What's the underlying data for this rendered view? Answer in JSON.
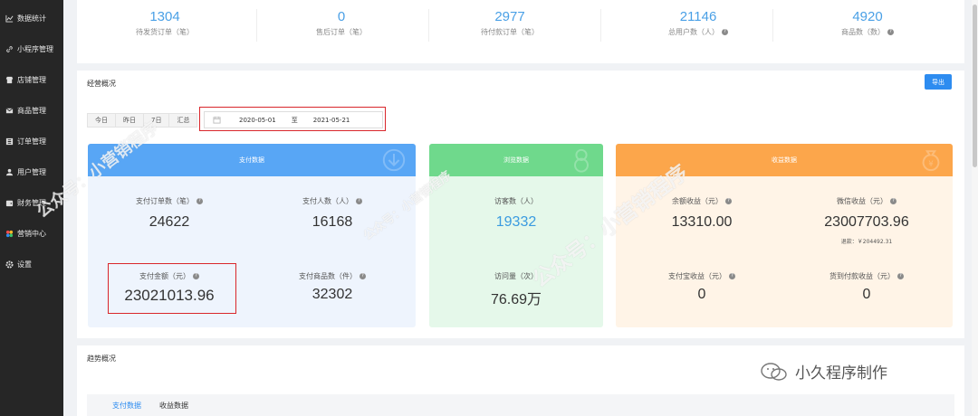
{
  "sidebar": {
    "items": [
      {
        "label": "数据统计",
        "icon": "chart-line-icon"
      },
      {
        "label": "小程序管理",
        "icon": "link-icon"
      },
      {
        "label": "店铺管理",
        "icon": "store-icon"
      },
      {
        "label": "商品管理",
        "icon": "envelope-icon"
      },
      {
        "label": "订单管理",
        "icon": "list-icon"
      },
      {
        "label": "用户管理",
        "icon": "user-icon"
      },
      {
        "label": "财务管理",
        "icon": "wallet-icon"
      },
      {
        "label": "营销中心",
        "icon": "marketing-icon"
      },
      {
        "label": "设置",
        "icon": "gear-icon"
      }
    ]
  },
  "summary": [
    {
      "value": "1304",
      "label": "待发货订单（笔）",
      "help": false
    },
    {
      "value": "0",
      "label": "售后订单（笔）",
      "help": false
    },
    {
      "value": "2977",
      "label": "待付款订单（笔）",
      "help": false
    },
    {
      "value": "21146",
      "label": "总用户数（人）",
      "help": true
    },
    {
      "value": "4920",
      "label": "商品数（数）",
      "help": true
    }
  ],
  "overview": {
    "title": "经营概况",
    "export_label": "导出",
    "ranges": [
      "今日",
      "昨日",
      "7日",
      "汇总"
    ],
    "date_start": "2020-05-01",
    "date_sep": "至",
    "date_end": "2021-05-21"
  },
  "panels": {
    "payment": {
      "title": "支付数据",
      "order_count_label": "支付订单数（笔）",
      "order_count": "24622",
      "payer_count_label": "支付人数（人）",
      "payer_count": "16168",
      "amount_label": "支付金额（元）",
      "amount": "23021013.96",
      "goods_count_label": "支付商品数（件）",
      "goods_count": "32302"
    },
    "browse": {
      "title": "浏览数据",
      "visitors_label": "访客数（人）",
      "visitors": "19332",
      "views_label": "访问量（次）",
      "views": "76.69万"
    },
    "income": {
      "title": "收益数据",
      "balance_label": "余额收益（元）",
      "balance": "13310.00",
      "wechat_label": "微信收益（元）",
      "wechat": "23007703.96",
      "refund_text": "退款：￥204492.31",
      "alipay_label": "支付宝收益（元）",
      "alipay": "0",
      "cod_label": "货到付款收益（元）",
      "cod": "0"
    }
  },
  "trend": {
    "title": "趋势概况",
    "tabs": [
      "支付数据",
      "收益数据"
    ]
  },
  "watermarks": {
    "text_1": "公众号：小营销程序",
    "text_2": "公众号：小营销程序",
    "text_3": "公众号：小营销程序",
    "signature": "小久程序制作"
  },
  "colors": {
    "accent": "#2d8cf0",
    "payment_panel": "#58a6f5",
    "browse_panel": "#6fd98c",
    "income_panel": "#fca64b",
    "highlight_frame": "#d9262b"
  }
}
